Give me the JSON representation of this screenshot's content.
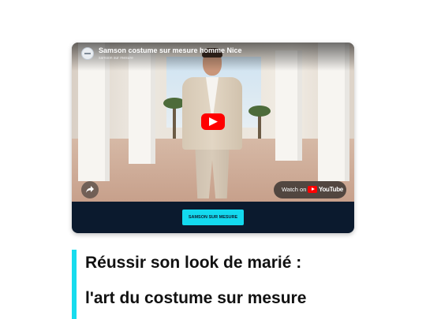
{
  "video": {
    "title": "Samson costume sur mesure homme Nice",
    "channel": "samson sur mesure",
    "watch_on_label": "Watch on",
    "youtube_word": "YouTube",
    "play_icon": "play-icon",
    "share_icon": "share-icon"
  },
  "cta": {
    "label": "SAMSON SUR MESURE"
  },
  "article": {
    "heading_line1": "Réussir son look de marié :",
    "heading_line2": "l'art du costume sur mesure"
  },
  "colors": {
    "accent": "#17dcee",
    "card_bg": "#0b1a2e",
    "play_red": "#ff0000"
  }
}
